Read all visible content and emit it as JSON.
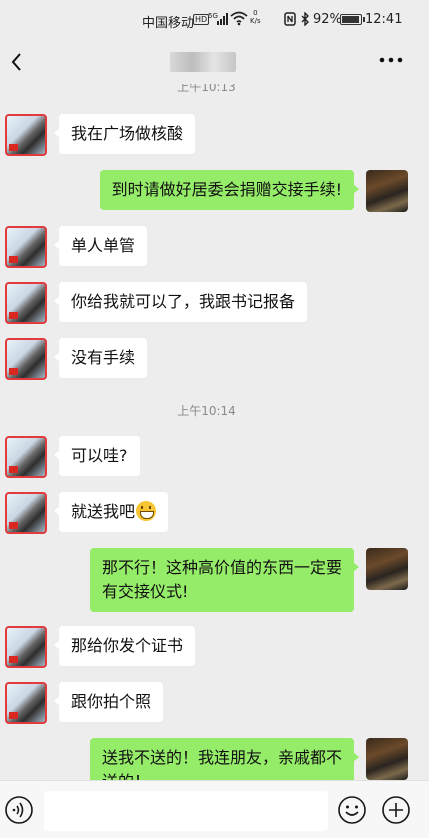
{
  "status_bar": {
    "carrier": "中国移动",
    "hd": "HD",
    "signal": "⁵ᴳ.ıl",
    "speed_value": "0",
    "speed_unit": "K/s",
    "battery_percent": "92%",
    "battery_level": 0.92,
    "time": "12:41"
  },
  "nav": {
    "back_icon": "chevron-left-icon",
    "more_icon": "more-dots-icon"
  },
  "timestamps": [
    "上午10:13",
    "上午10:14"
  ],
  "messages": [
    {
      "from": "peer",
      "text": "我在广场做核酸"
    },
    {
      "from": "me",
      "text": "到时请做好居委会捐赠交接手续!"
    },
    {
      "from": "peer",
      "text": "单人单管"
    },
    {
      "from": "peer",
      "text": "你给我就可以了，我跟书记报备"
    },
    {
      "from": "peer",
      "text": "没有手续"
    },
    {
      "from": "peer",
      "text": "可以哇?"
    },
    {
      "from": "peer",
      "text": "就送我吧",
      "emoji": "grin-emoji-icon"
    },
    {
      "from": "me",
      "line1": "那不行！这种高价值的东西一定要",
      "line2": "有交接仪式!"
    },
    {
      "from": "peer",
      "text": "那给你发个证书"
    },
    {
      "from": "peer",
      "text": "跟你拍个照"
    },
    {
      "from": "me",
      "line1": "送我不送的！我连朋友，亲戚都不",
      "line2": "送的！"
    }
  ],
  "input_bar": {
    "value": "",
    "icons": [
      "voice-icon",
      "emoji-icon",
      "plus-icon"
    ]
  },
  "colors": {
    "background": "#ededed",
    "my_bubble": "#95ec69",
    "peer_bubble": "#ffffff"
  }
}
